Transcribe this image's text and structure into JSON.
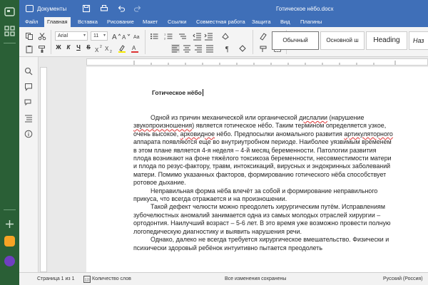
{
  "titlebar": {
    "documents_label": "Документы",
    "filename": "Готическое нёбо.docx"
  },
  "menu": {
    "tabs": [
      "Файл",
      "Главная",
      "Вставка",
      "Рисование",
      "Макет",
      "Ссылки",
      "Совместная работа",
      "Защита",
      "Вид",
      "Плагины"
    ],
    "active_tab": "Главная"
  },
  "ribbon": {
    "font_name": "Arial",
    "font_size": "11",
    "bold": "Ж",
    "italic": "К",
    "underline": "Ч",
    "strike": "S",
    "styles": [
      "Обычный",
      "Основной ш",
      "Heading",
      "Наз"
    ]
  },
  "document": {
    "title": "Готическое нёбо",
    "p1_a": "Одной из  причин  механической или органической ",
    "p1_b": "дислалии",
    "p1_c": " (нарушение ",
    "p1_d": "звукопроизношения",
    "p1_e": ") является готическое нёбо. Таким термином определяется узкое, очень высокое, ",
    "p1_f": "арковидное",
    "p1_g": " нёбо. Предпосылки аномального развития ",
    "p1_h": "артикуляторного",
    "p1_i": " аппарата появляются еще во внутриутробном периоде. Наиболее уязвимым временем в этом плане является  4-я неделя – 4-й месяц беременности. Патологии развития плода возникают на фоне тяжёлого токсикоза беременности, несовместимости матери и плода по резус-фактору, травм, интоксикаций, вирусных и эндокринных заболеваний матери. Помимо указанных факторов, формированию готического нёба способствует ротовое дыхание.",
    "p2": "Неправильная форма нёба влечёт за собой и формирование неправильного прикуса, что всегда отражается и на произношении.",
    "p3": "Такой дефект челюсти можно преодолеть хирургическим путём. Исправлениям зубочелюстных аномалий занимается одна из самых молодых отраслей хирургии – ортодонтия. Наилучший возраст – 5-6 лет. В это время уже возможно провести полную логопедическую диагностику и выявить нарушения речи.",
    "p4": "Однако, далеко не всегда требуется хирургическое вмешательство. Физически и психически здоровый ребёнок интуитивно пытается преодолеть"
  },
  "status": {
    "page": "Страница 1 из 1",
    "word_count": "Количество слов",
    "saved": "Все изменения сохранены",
    "language": "Русский (Россия)"
  },
  "colors": {
    "titlebar": "#3f6fb8",
    "dock": "#2a5f36",
    "spell_error": "#dd3333"
  }
}
